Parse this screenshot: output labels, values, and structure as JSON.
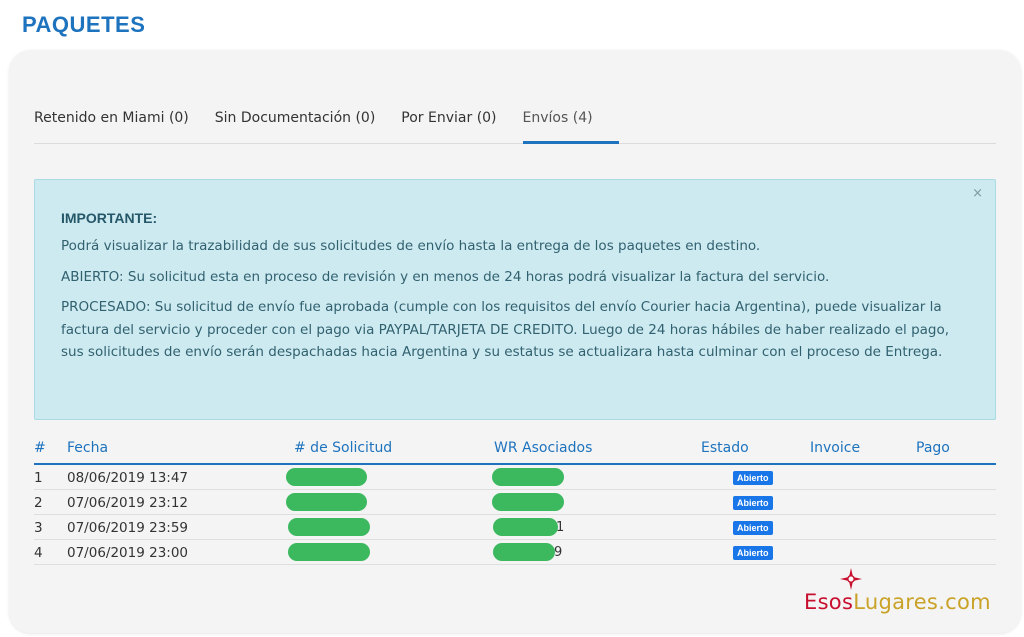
{
  "header": {
    "title": "PAQUETES"
  },
  "tabs": [
    {
      "label": "Retenido en Miami (0)"
    },
    {
      "label": "Sin Documentación (0)"
    },
    {
      "label": "Por Enviar (0)"
    },
    {
      "label": "Envíos (4)"
    }
  ],
  "active_tab": "Envíos (4)",
  "alert": {
    "close": "×",
    "heading": "IMPORTANTE:",
    "p1": "Podrá visualizar la trazabilidad de sus solicitudes de envío hasta la entrega de los paquetes en destino.",
    "p2": "ABIERTO: Su solicitud esta en proceso de revisión y en menos de 24 horas podrá visualizar la factura del servicio.",
    "p3": "PROCESADO: Su solicitud de envío fue aprobada (cumple con los requisitos del envío Courier hacia Argentina), puede visualizar la factura del servicio y proceder con el pago via PAYPAL/TARJETA DE CREDITO. Luego de 24 horas hábiles de haber realizado el pago, sus solicitudes de envío serán despachadas hacia Argentina y su estatus se actualizara hasta culminar con el proceso de Entrega."
  },
  "table": {
    "headers": {
      "num": "#",
      "fecha": "Fecha",
      "solicitud": "# de Solicitud",
      "wr": "WR Asociados",
      "estado": "Estado",
      "invoice": "Invoice",
      "pago": "Pago"
    },
    "rows": [
      {
        "num": "1",
        "fecha": "08/06/2019 13:47",
        "estado": "Abierto",
        "wr_tail": ""
      },
      {
        "num": "2",
        "fecha": "07/06/2019 23:12",
        "estado": "Abierto",
        "wr_tail": ""
      },
      {
        "num": "3",
        "fecha": "07/06/2019 23:59",
        "estado": "Abierto",
        "wr_tail": "1"
      },
      {
        "num": "4",
        "fecha": "07/06/2019 23:00",
        "estado": "Abierto",
        "wr_tail": "9"
      }
    ]
  },
  "watermark": {
    "part1": "Esos",
    "part2": "Lugares",
    "part3": ".com"
  },
  "colors": {
    "accent": "#1e73be",
    "alert_bg": "#cdeaf1",
    "badge": "#1976e8",
    "redaction": "#3cb85f",
    "wm_red": "#c8102e",
    "wm_gold": "#c9a227"
  }
}
